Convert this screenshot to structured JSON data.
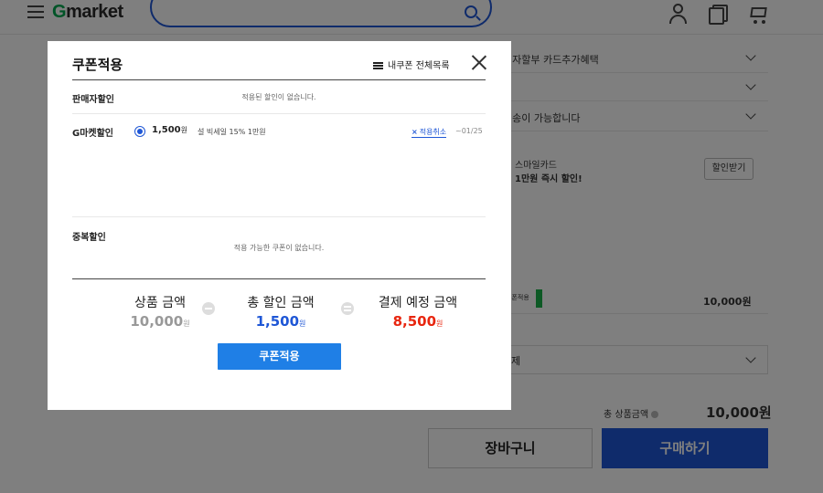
{
  "header": {
    "logo": "Gmarket",
    "search_placeholder": ""
  },
  "background": {
    "rows": [
      {
        "text": "이자할부  카드추가혜택"
      },
      {
        "text": ""
      },
      {
        "text": "배송이 가능합니다"
      }
    ],
    "smile_card_title": "스마일카드",
    "smile_card_offer": "1만원 즉시 할인!",
    "smile_card_button": "할인받기",
    "coupon_small": "쿠폰적용",
    "price_row_value": "10,000원",
    "option_select": "제",
    "total_label": "총 상품금액",
    "total_value": "10,000원",
    "cart_button": "장바구니",
    "buy_button": "구매하기"
  },
  "modal": {
    "title": "쿠폰적용",
    "list_link": "내쿠폰 전체목록",
    "seller_discount": {
      "label": "판매자할인",
      "empty_message": "적용된 할인이 없습니다."
    },
    "gmarket_discount": {
      "label": "G마켓할인",
      "coupon_amount": "1,500",
      "coupon_won": "원",
      "coupon_name": "설 빅세일 15% 1만원",
      "cancel_label": "적용취소",
      "expiry": "~01/25",
      "selected": true
    },
    "duplicate_discount": {
      "label": "중복할인",
      "empty_message": "적용 가능한 쿠폰이 없습니다."
    },
    "summary": {
      "product_label": "상품 금액",
      "product_value": "10,000",
      "discount_label": "총 할인 금액",
      "discount_value": "1,500",
      "payment_label": "결제 예정 금액",
      "payment_value": "8,500",
      "won": "원"
    },
    "apply_button": "쿠폰적용"
  },
  "colors": {
    "brand_blue": "#1f57d6",
    "apply_blue": "#1f7fe6",
    "discount_blue": "#1f57d6",
    "payment_red": "#e8260f",
    "brand_green": "#00a84f"
  }
}
